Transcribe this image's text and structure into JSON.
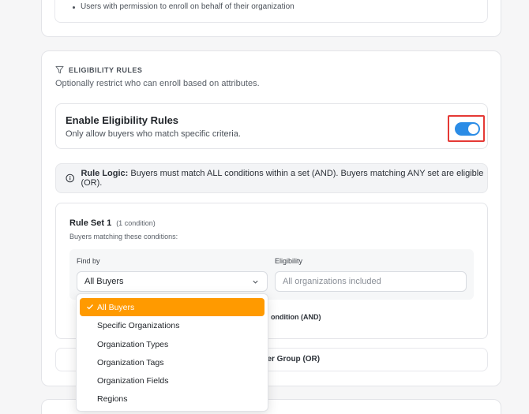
{
  "top_card": {
    "bullet": "Users with permission to enroll on behalf of their organization"
  },
  "eligibility": {
    "section_title": "ELIGIBILITY RULES",
    "section_desc": "Optionally restrict who can enroll based on attributes.",
    "toggle": {
      "title": "Enable Eligibility Rules",
      "desc": "Only allow buyers who match specific criteria.",
      "enabled": true
    },
    "logic": {
      "label": "Rule Logic:",
      "text": "Buyers must match ALL conditions within a set (AND). Buyers matching ANY set are eligible (OR)."
    },
    "rule_set": {
      "title": "Rule Set 1",
      "count": "(1 condition)",
      "subtitle": "Buyers matching these conditions:",
      "find_by_label": "Find by",
      "find_by_value": "All Buyers",
      "eligibility_label": "Eligibility",
      "eligibility_value": "All organizations included",
      "add_condition_partial": "ondition (AND)"
    },
    "add_group_partial": "ther Group (OR)"
  },
  "dropdown": {
    "options": [
      "All Buyers",
      "Specific Organizations",
      "Organization Types",
      "Organization Tags",
      "Organization Fields",
      "Regions"
    ],
    "selected": "All Buyers"
  },
  "colors": {
    "accent": "#ff9a00",
    "toggle": "#2b8ce6",
    "highlight": "#e53935"
  }
}
